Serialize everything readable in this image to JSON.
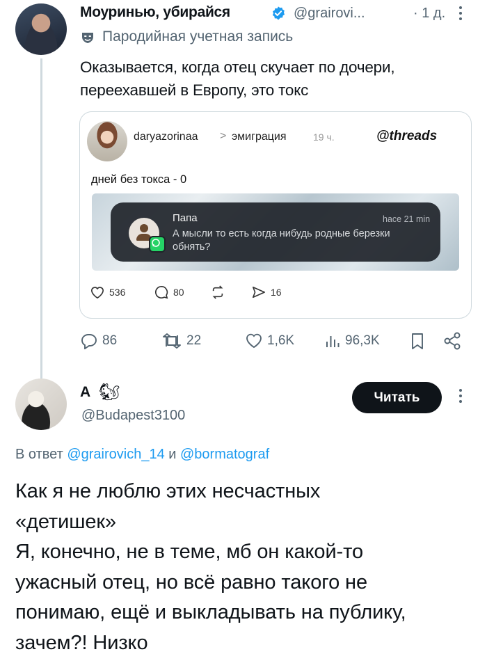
{
  "tweet": {
    "author_name": "Моуринью, убирайся",
    "handle": "@grairovi...",
    "time": "· 1 д.",
    "parody_label": "Пародийная учетная запись",
    "text_lines": [
      "Оказывается, когда отец скучает по дочери,",
      "переехавшей в Европу, это токс"
    ],
    "quoted_card": {
      "username": "daryazorinaa",
      "separator": ">",
      "topic": "эмиграция",
      "time": "19 ч.",
      "brand": "threads",
      "line": "дней без токса - 0",
      "notification": {
        "sender": "Папа",
        "time": "hace 21 min",
        "message": "А мысли то есть когда нибудь родные березки обнять?"
      },
      "stats": {
        "likes": "536",
        "comments": "80",
        "shares": "16"
      }
    },
    "actions": {
      "replies": "86",
      "retweets": "22",
      "likes": "1,6K",
      "views": "96,3K"
    }
  },
  "reply": {
    "author_name": "А",
    "emoji": "🐿",
    "handle": "@Budapest3100",
    "read_button": "Читать",
    "reply_prefix": "В ответ",
    "mention1": "@grairovich_14",
    "joiner": "и",
    "mention2": "@bormatograf",
    "text_lines": [
      "Как я не люблю этих несчастных",
      "«детишек»",
      "Я, конечно, не в теме, мб он какой-то",
      "ужасный отец, но всё равно такого не",
      "понимаю, ещё и выкладывать на публику,",
      "зачем?! Низко"
    ]
  },
  "colors": {
    "accent": "#1d9bf0",
    "muted": "#536471",
    "text": "#0f1419",
    "button": "#0f1419"
  }
}
